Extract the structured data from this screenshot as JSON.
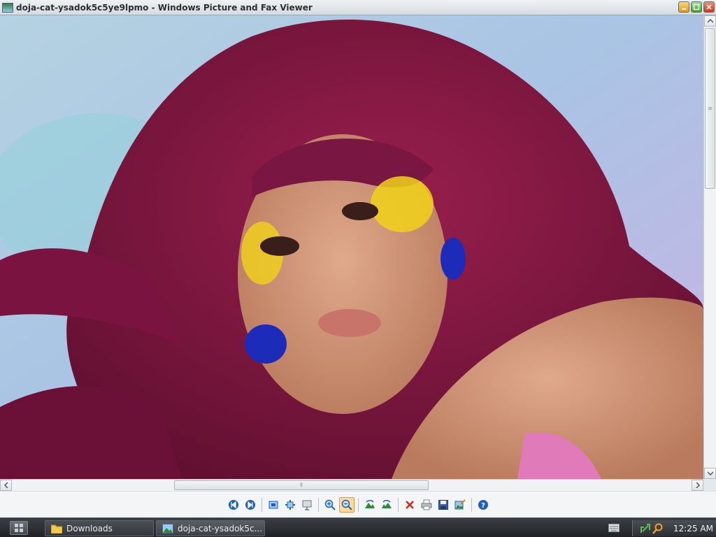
{
  "window": {
    "title": "doja-cat-ysadok5c5ye9lpmo - Windows Picture and Fax Viewer"
  },
  "viewer": {
    "image_description": "portrait photo"
  },
  "toolbar": {
    "buttons": [
      {
        "name": "previous-image-button",
        "icon": "previous-icon"
      },
      {
        "name": "next-image-button",
        "icon": "next-icon"
      },
      {
        "name": "best-fit-button",
        "icon": "best-fit-icon"
      },
      {
        "name": "actual-size-button",
        "icon": "actual-size-icon"
      },
      {
        "name": "slide-show-button",
        "icon": "slideshow-icon"
      },
      {
        "name": "zoom-in-button",
        "icon": "zoom-in-icon"
      },
      {
        "name": "zoom-out-button",
        "icon": "zoom-out-icon",
        "active": true
      },
      {
        "name": "rotate-clockwise-button",
        "icon": "rotate-cw-icon"
      },
      {
        "name": "rotate-counterclockwise-button",
        "icon": "rotate-ccw-icon"
      },
      {
        "name": "delete-button",
        "icon": "delete-icon"
      },
      {
        "name": "print-button",
        "icon": "print-icon"
      },
      {
        "name": "copy-to-button",
        "icon": "save-icon"
      },
      {
        "name": "open-for-editing-button",
        "icon": "edit-icon"
      },
      {
        "name": "help-button",
        "icon": "help-icon"
      }
    ],
    "accent": "#1f5fbf",
    "active_bg": "#ffd9a0"
  },
  "taskbar": {
    "tasks": [
      {
        "label": "Downloads",
        "icon": "folder-icon"
      },
      {
        "label": "doja-cat-ysadok5c...",
        "icon": "image-icon"
      }
    ],
    "clock": "12:25 AM"
  }
}
